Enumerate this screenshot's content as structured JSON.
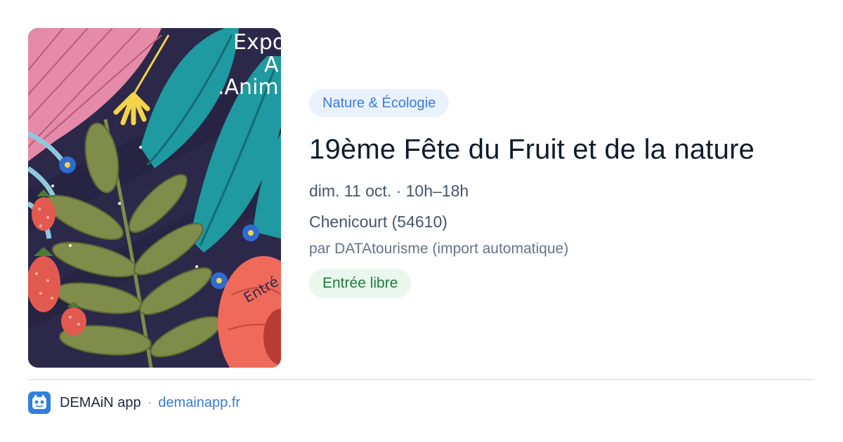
{
  "poster": {
    "text_lines": [
      "Expo",
      "A",
      ".Anim",
      "Entré"
    ],
    "colors": {
      "background": "#2a2748",
      "teal": "#1e9aa0",
      "pink": "#e58aa8",
      "leaf": "#7f8c4a",
      "strawberry": "#e25a4f",
      "flower": "#ef6a5a"
    }
  },
  "event": {
    "category": "Nature & Écologie",
    "title": "19ème Fête du Fruit et de la nature",
    "date": "dim. 11 oct. · 10h–18h",
    "location": "Chenicourt (54610)",
    "source": "par DATAtourisme (import automatique)",
    "price": "Entrée libre"
  },
  "footer": {
    "app_name": "DEMAiN app",
    "separator": "·",
    "domain": "demainapp.fr",
    "logo_icon": "demain-logo-icon"
  },
  "colors": {
    "accent": "#3b7bd6",
    "category_bg": "#eaf2fd",
    "price_text": "#1f7a3f",
    "price_bg": "#eaf7ee"
  }
}
